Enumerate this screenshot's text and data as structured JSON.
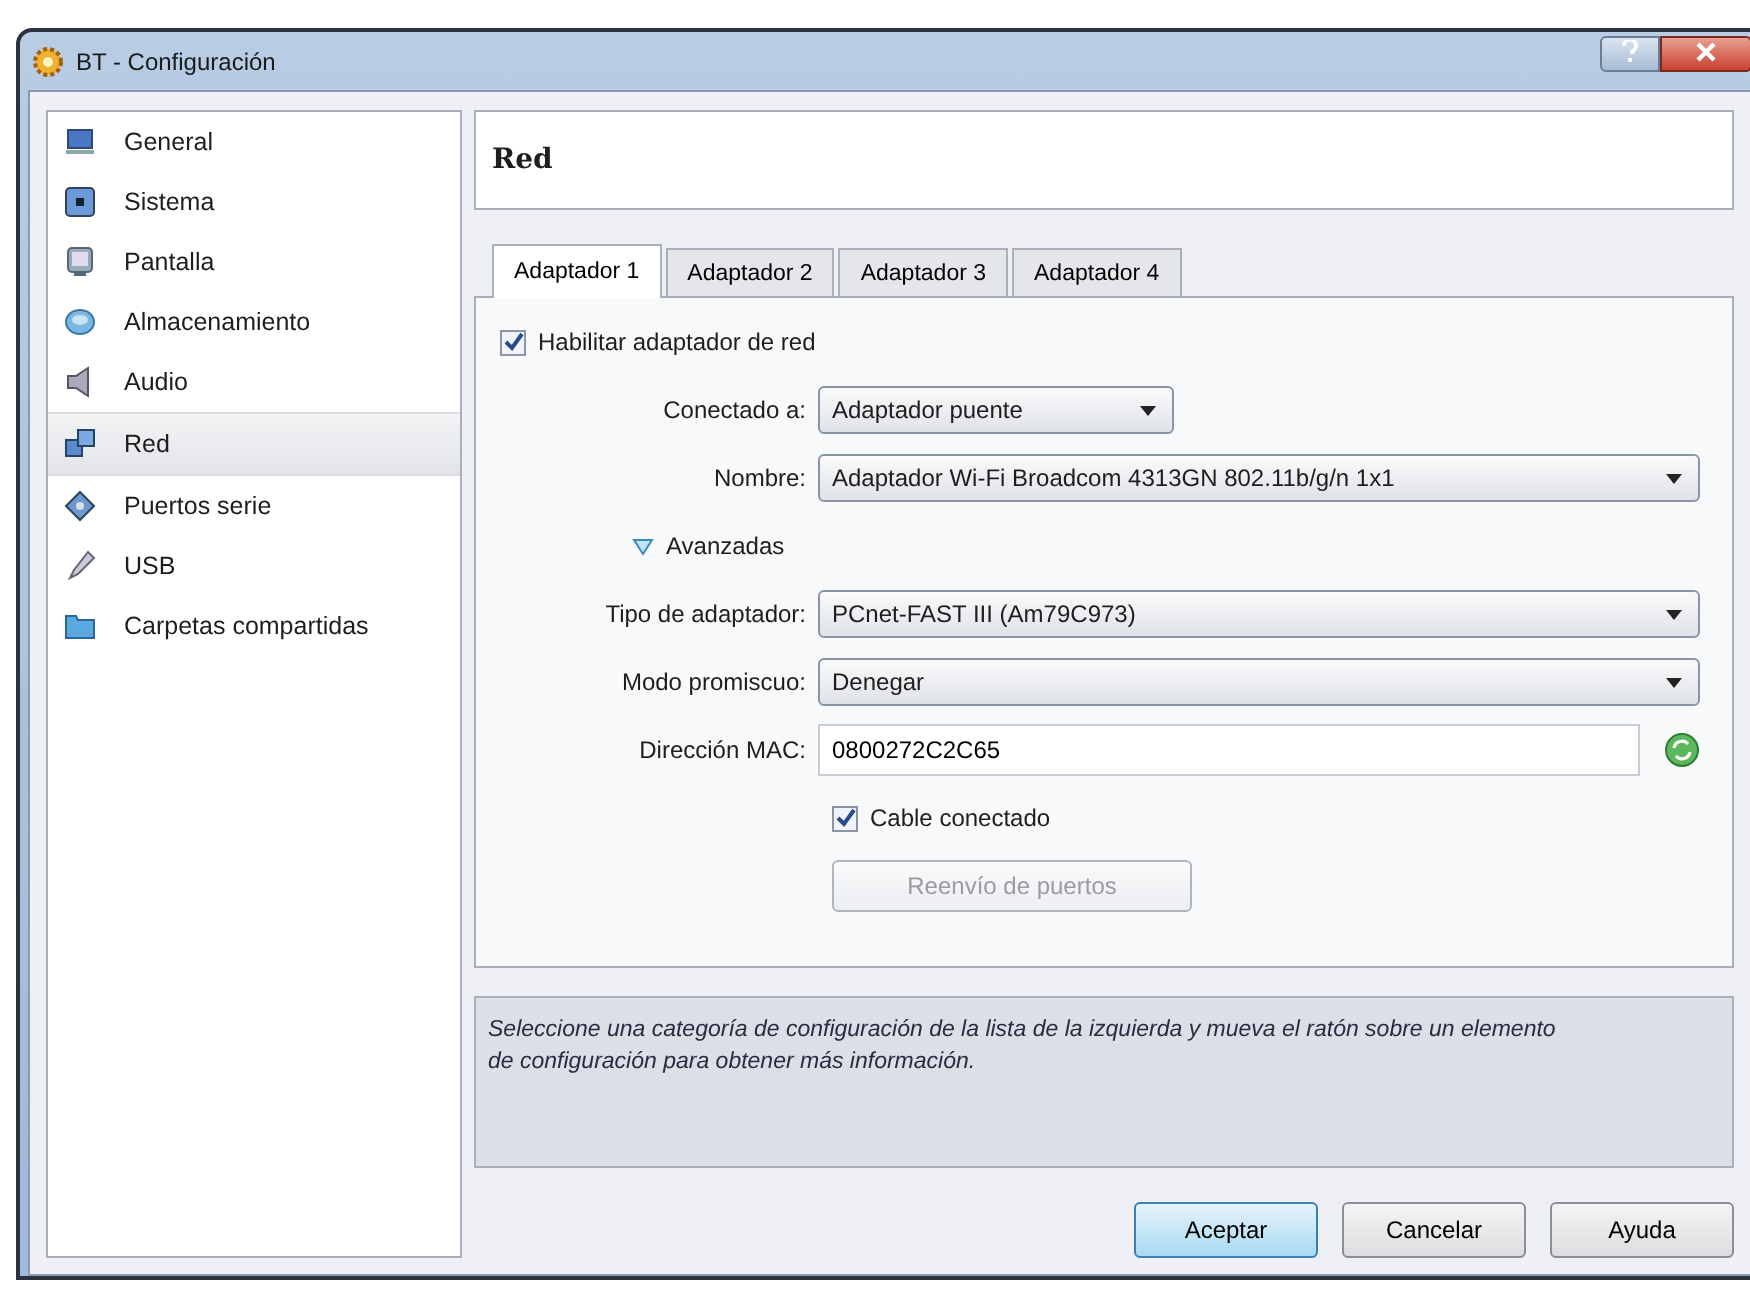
{
  "window": {
    "title": "BT - Configuración"
  },
  "sidebar": {
    "items": [
      {
        "label": "General",
        "selected": false
      },
      {
        "label": "Sistema",
        "selected": false
      },
      {
        "label": "Pantalla",
        "selected": false
      },
      {
        "label": "Almacenamiento",
        "selected": false
      },
      {
        "label": "Audio",
        "selected": false
      },
      {
        "label": "Red",
        "selected": true
      },
      {
        "label": "Puertos serie",
        "selected": false
      },
      {
        "label": "USB",
        "selected": false
      },
      {
        "label": "Carpetas compartidas",
        "selected": false
      }
    ]
  },
  "section_title": "Red",
  "tabs": [
    {
      "label": "Adaptador 1",
      "selected": true
    },
    {
      "label": "Adaptador 2",
      "selected": false
    },
    {
      "label": "Adaptador 3",
      "selected": false
    },
    {
      "label": "Adaptador 4",
      "selected": false
    }
  ],
  "fields": [
    {
      "kind": "checkbox",
      "label": "Habilitar adaptador de red",
      "checked": true,
      "indented": false
    },
    {
      "kind": "select",
      "label": "Conectado a:",
      "value": "Adaptador puente",
      "short": true
    },
    {
      "kind": "select",
      "label": "Nombre:",
      "value": "Adaptador Wi-Fi Broadcom 4313GN 802.11b/g/n 1x1",
      "short": false
    },
    {
      "kind": "expander",
      "label": "Avanzadas",
      "expanded": true
    },
    {
      "kind": "select",
      "label": "Tipo de adaptador:",
      "value": "PCnet-FAST III (Am79C973)",
      "short": false
    },
    {
      "kind": "select",
      "label": "Modo promiscuo:",
      "value": "Denegar",
      "short": false
    },
    {
      "kind": "text",
      "label": "Dirección MAC:",
      "value": "0800272C2C65"
    },
    {
      "kind": "checkbox",
      "label": "Cable conectado",
      "checked": true,
      "indented": true
    },
    {
      "kind": "button",
      "label": "Reenvío de puertos",
      "disabled": true
    }
  ],
  "info": "Seleccione una categoría de configuración de la lista de la izquierda y mueva el ratón sobre un elemento de configuración para obtener más información.",
  "buttons": [
    {
      "label": "Aceptar",
      "default": true
    },
    {
      "label": "Cancelar",
      "default": false
    },
    {
      "label": "Ayuda",
      "default": false
    }
  ]
}
